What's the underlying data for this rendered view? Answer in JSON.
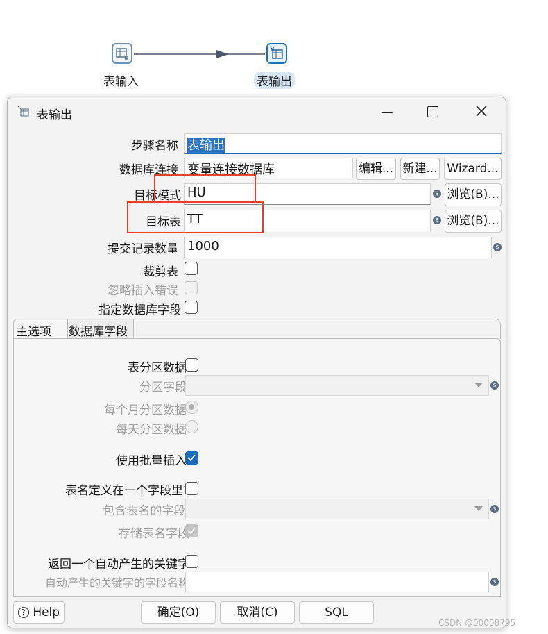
{
  "canvas": {
    "node_input_label": "表输入",
    "node_output_label": "表输出"
  },
  "dialog": {
    "title": "表输出",
    "step_name_label": "步骤名称",
    "step_name_value": "表输出",
    "db_conn_label": "数据库连接",
    "db_conn_value": "变量连接数据库",
    "edit_btn": "编辑...",
    "new_btn": "新建...",
    "wizard_btn": "Wizard...",
    "target_schema_label": "目标模式",
    "target_schema_value": "HU",
    "browse_btn": "浏览(B)...",
    "target_table_label": "目标表",
    "target_table_value": "TT",
    "commit_size_label": "提交记录数量",
    "commit_size_value": "1000",
    "truncate_label": "裁剪表",
    "ignore_errors_label": "忽略插入错误",
    "specify_fields_label": "指定数据库字段",
    "tabs": [
      "主选项",
      "数据库字段"
    ],
    "partition_label": "表分区数据",
    "partition_field_label": "分区字段",
    "monthly_label": "每个月分区数据",
    "daily_label": "每天分区数据",
    "batch_label": "使用批量插入",
    "table_in_field_label": "表名定义在一个字段里?",
    "table_name_field_label": "包含表名的字段:",
    "store_table_field_label": "存储表名字段",
    "return_key_label": "返回一个自动产生的关键字",
    "key_field_name_label": "自动产生的关键字的字段名称",
    "help_btn": "Help",
    "ok_btn": "确定(O)",
    "cancel_btn": "取消(C)",
    "sql_btn": "SQL"
  },
  "watermark": "CSDN @00008795",
  "colors": {
    "accent": "#1f6ab8",
    "highlight_box": "#e8402a"
  }
}
